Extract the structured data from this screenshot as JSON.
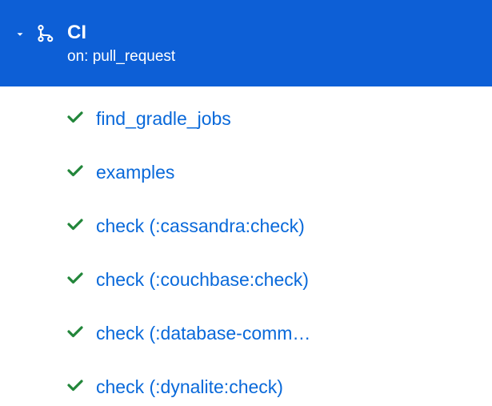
{
  "header": {
    "title": "CI",
    "trigger": "on: pull_request"
  },
  "jobs": [
    {
      "status": "success",
      "name": "find_gradle_jobs"
    },
    {
      "status": "success",
      "name": "examples"
    },
    {
      "status": "success",
      "name": "check (:cassandra:check)"
    },
    {
      "status": "success",
      "name": "check (:couchbase:check)"
    },
    {
      "status": "success",
      "name": "check (:database-comm…"
    },
    {
      "status": "success",
      "name": "check (:dynalite:check)"
    }
  ]
}
